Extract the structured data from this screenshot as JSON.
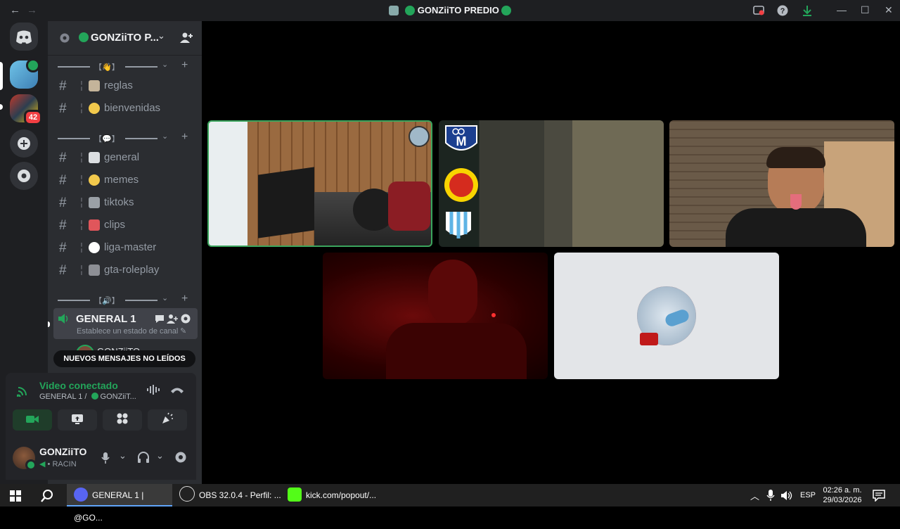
{
  "titlebar": {
    "title": "GONZiiTO PREDIO",
    "back": "←",
    "forward": "→",
    "minimize": "—",
    "maximize": "☐",
    "close": "✕"
  },
  "server": {
    "name": "GONZiiTO P...",
    "badge_count": "42"
  },
  "categories": [
    {
      "label": "【👋】"
    },
    {
      "label": "【💬】"
    },
    {
      "label": "【🔊】"
    }
  ],
  "channels": [
    {
      "name": "reglas",
      "emoji_color": "#c4b49a"
    },
    {
      "name": "bienvenidas",
      "emoji_color": "#f2c94c"
    },
    {
      "name": "general",
      "emoji_color": "#dbdee1"
    },
    {
      "name": "memes",
      "emoji_color": "#f2c94c"
    },
    {
      "name": "tiktoks",
      "emoji_color": "#9aa0a6"
    },
    {
      "name": "clips",
      "emoji_color": "#e0565b"
    },
    {
      "name": "liga-master",
      "emoji_color": "#ffffff"
    },
    {
      "name": "gta-roleplay",
      "emoji_color": "#8d8f95"
    }
  ],
  "voice_channel": {
    "name": "GENERAL 1",
    "status": "Establece un estado de canal",
    "member_partial": "GONZiiTO"
  },
  "new_messages": "NUEVOS MENSAJES NO LEÍDOS",
  "rtc": {
    "status": "Video conectado",
    "location": "GENERAL 1 / ",
    "server_short": "GONZiiT..."
  },
  "user": {
    "name": "GONZiiTO",
    "activity": "RACIN"
  },
  "taskbar": {
    "tasks": [
      {
        "label": "GENERAL 1 | @GO..."
      },
      {
        "label": "OBS 32.0.4 - Perfil: ..."
      },
      {
        "label": "kick.com/popout/..."
      }
    ],
    "lang": "ESP",
    "time": "02:26 a. m.",
    "date": "29/03/2026"
  },
  "colors": {
    "accent_green": "#23a55a",
    "speaking_border": "#3ba55d",
    "blurple": "#5865f2",
    "badge_red": "#f23f43"
  }
}
